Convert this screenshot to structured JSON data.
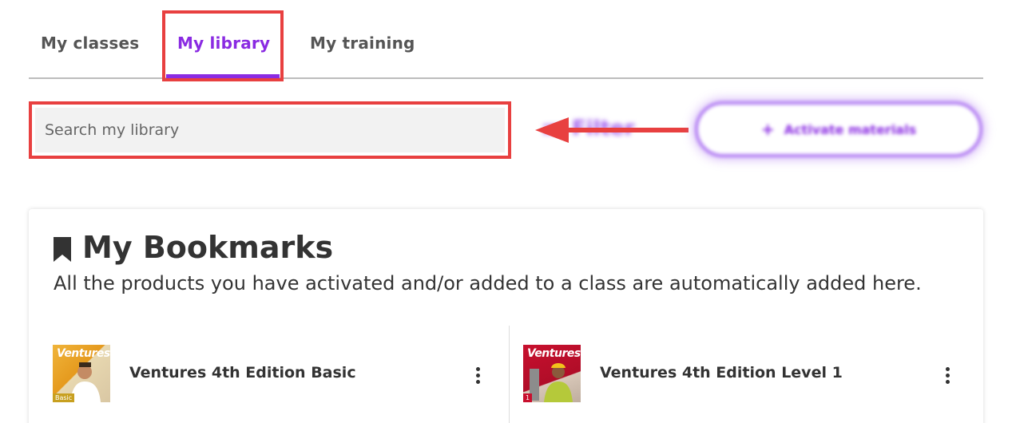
{
  "tabs": [
    {
      "label": "My classes"
    },
    {
      "label": "My library"
    },
    {
      "label": "My training"
    }
  ],
  "search": {
    "placeholder": "Search my library"
  },
  "filter": {
    "label": "Filter"
  },
  "activate": {
    "label": "Activate materials"
  },
  "bookmarks": {
    "title": "My Bookmarks",
    "description": "All the products you have activated and/or added to a class are automatically added here.",
    "items": [
      {
        "title": "Ventures 4th Edition Basic",
        "cover_brand": "Ventures",
        "cover_level": "Basic"
      },
      {
        "title": "Ventures 4th Edition Level 1",
        "cover_brand": "Ventures",
        "cover_level": "1"
      }
    ]
  },
  "colors": {
    "accent": "#8a2be2",
    "annotation": "#e84040"
  }
}
